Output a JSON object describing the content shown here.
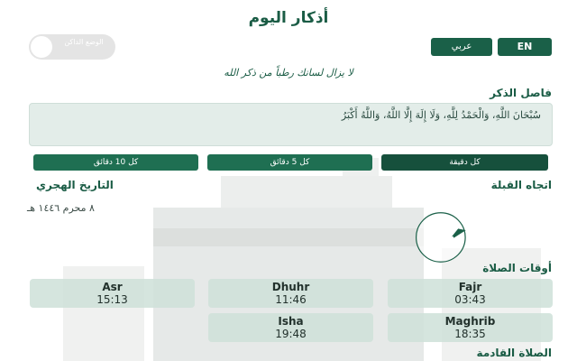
{
  "header": {
    "title": "أذكار اليوم",
    "toggle_label": "الوضع الداكن",
    "lang_ar": "عربي",
    "lang_en": "EN"
  },
  "tagline": "لا يزال لسانك رطباً من ذكر الله",
  "dhikr": {
    "heading": "فاصل الذكر",
    "text": "سُبْحَانَ اللَّهِ، وَالْحَمْدُ لِلَّهِ، وَلَا إِلَهَ إِلَّا اللَّهُ، وَاللَّهُ أَكْبَرُ",
    "intervals": [
      "كل 10 دقائق",
      "كل 5 دقائق",
      "كل دقيقة"
    ]
  },
  "hijri": {
    "heading": "التاريخ الهجري",
    "date": "٨ محرم ١٤٤٦ هـ"
  },
  "qibla": {
    "heading": "اتجاه القبلة"
  },
  "prayers": {
    "heading": "أوقات الصلاة",
    "items": [
      {
        "name": "Fajr",
        "time": "03:43"
      },
      {
        "name": "Dhuhr",
        "time": "11:46"
      },
      {
        "name": "Asr",
        "time": "15:13"
      },
      {
        "name": "Maghrib",
        "time": "18:35"
      },
      {
        "name": "Isha",
        "time": "19:48"
      }
    ]
  },
  "next_prayer": {
    "heading": "الصلاة القادمة"
  },
  "colors": {
    "primary": "#1a6048",
    "card": "#cee0d8"
  }
}
